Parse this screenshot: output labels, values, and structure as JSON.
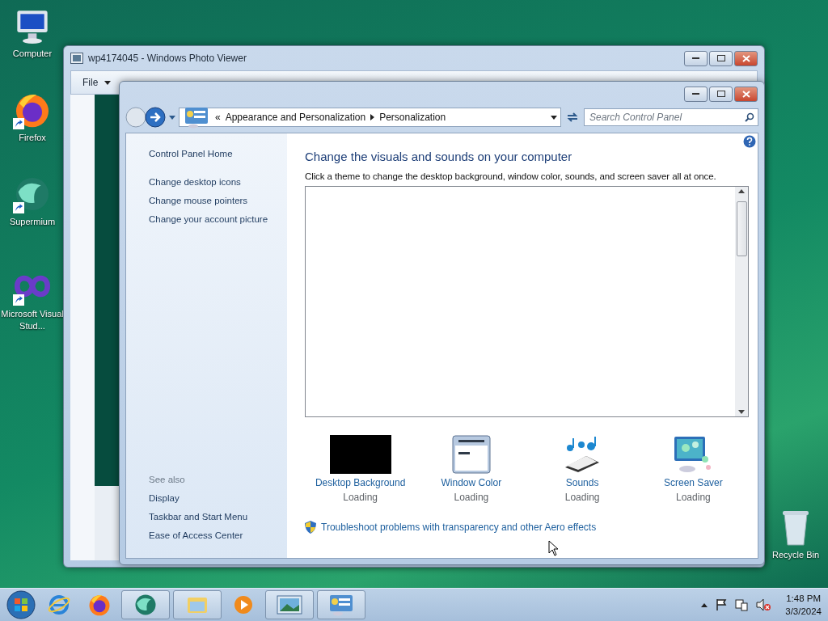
{
  "desktop_icons": [
    {
      "label": "Computer",
      "kind": "computer",
      "shortcut": false
    },
    {
      "label": "Firefox",
      "kind": "firefox",
      "shortcut": true
    },
    {
      "label": "Supermium",
      "kind": "supermium",
      "shortcut": true
    },
    {
      "label": "Microsoft Visual Stud...",
      "kind": "vs",
      "shortcut": true
    }
  ],
  "recycle_bin": {
    "label": "Recycle Bin"
  },
  "photo_viewer": {
    "title": "wp4174045 - Windows Photo Viewer",
    "menu": [
      {
        "label": "File"
      }
    ]
  },
  "control_panel": {
    "address": {
      "chevron": "«",
      "crumbs": [
        "Appearance and Personalization",
        "Personalization"
      ]
    },
    "search": {
      "placeholder": "Search Control Panel"
    },
    "sidebar": {
      "home": "Control Panel Home",
      "links": [
        "Change desktop icons",
        "Change mouse pointers",
        "Change your account picture"
      ],
      "see_also_title": "See also",
      "see_also": [
        "Display",
        "Taskbar and Start Menu",
        "Ease of Access Center"
      ]
    },
    "heading": "Change the visuals and sounds on your computer",
    "description": "Click a theme to change the desktop background, window color, sounds, and screen saver all at once.",
    "settings": [
      {
        "kind": "background",
        "label": "Desktop Background",
        "status": "Loading"
      },
      {
        "kind": "color",
        "label": "Window Color",
        "status": "Loading"
      },
      {
        "kind": "sounds",
        "label": "Sounds",
        "status": "Loading"
      },
      {
        "kind": "saver",
        "label": "Screen Saver",
        "status": "Loading"
      }
    ],
    "troubleshoot": "Troubleshoot problems with transparency and other Aero effects"
  },
  "taskbar": {
    "items": [
      {
        "kind": "ie",
        "open": false
      },
      {
        "kind": "firefox",
        "open": false
      },
      {
        "kind": "supermium",
        "open": true
      },
      {
        "kind": "explorer",
        "open": true
      },
      {
        "kind": "media",
        "open": false
      },
      {
        "kind": "photos",
        "open": true
      },
      {
        "kind": "control",
        "open": true
      }
    ],
    "time": "1:48 PM",
    "date": "3/3/2024"
  }
}
